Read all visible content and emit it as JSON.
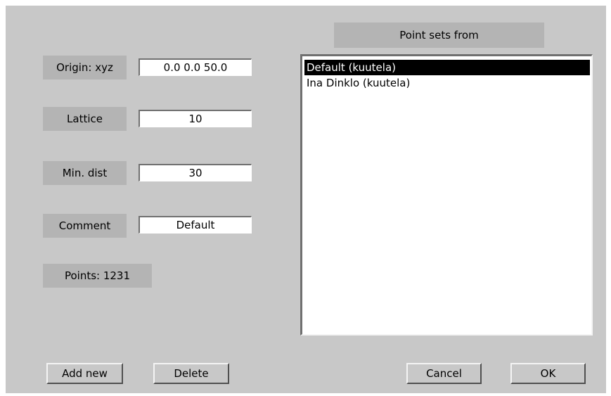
{
  "list_header": "Point sets from",
  "fields": {
    "origin": {
      "label": "Origin: xyz",
      "value": "0.0 0.0 50.0"
    },
    "lattice": {
      "label": "Lattice",
      "value": "10"
    },
    "min_dist": {
      "label": "Min. dist",
      "value": "30"
    },
    "comment": {
      "label": "Comment",
      "value": "Default"
    }
  },
  "points_label": "Points: 1231",
  "point_sets": [
    {
      "label": "Default (kuutela)",
      "selected": true
    },
    {
      "label": "Ina Dinklo (kuutela)",
      "selected": false
    }
  ],
  "buttons": {
    "add_new": "Add new",
    "delete": "Delete",
    "cancel": "Cancel",
    "ok": "OK"
  }
}
